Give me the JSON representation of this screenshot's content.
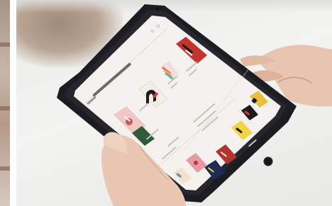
{
  "scene": {
    "description_tag": "hands-holding-tablet-reading-app",
    "colors": {
      "tablet_bezel": "#1c1d22",
      "screen_bg": "#f4f1ee",
      "skin": "#e9c7b3",
      "table": "#efefed",
      "accent_red": "#d23a34",
      "accent_yellow": "#f0c53a"
    }
  },
  "app": {
    "header_title": "",
    "section_labels": [
      "",
      "",
      "",
      ""
    ]
  },
  "books": [
    {
      "icon": "book-cover-red-title",
      "color": "#c2332c"
    },
    {
      "icon": "book-cover-rainbow",
      "color": "#e36f86"
    },
    {
      "icon": "book-cover-white-black-mark",
      "color": "#f3ede6"
    },
    {
      "icon": "book-cover-pink-illustration",
      "color": "#f0c7c4"
    },
    {
      "icon": "book-cover-yellow-grid",
      "color": "#e9c03c"
    },
    {
      "icon": "book-cover-dark-red",
      "color": "#b3332d"
    },
    {
      "icon": "book-cover-navy",
      "color": "#1e2b52"
    },
    {
      "icon": "book-cover-pink-red",
      "color": "#e79aa3"
    },
    {
      "icon": "book-cover-yellow-black",
      "color": "#f3d447"
    }
  ]
}
